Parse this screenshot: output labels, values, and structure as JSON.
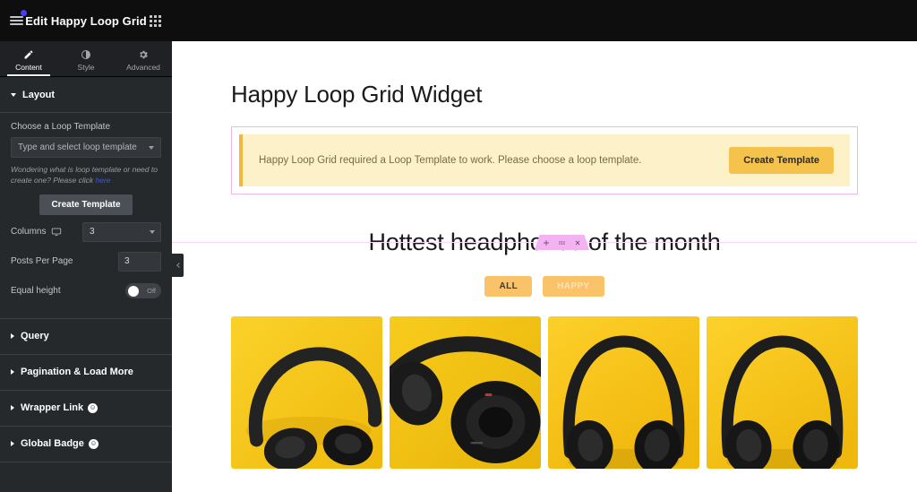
{
  "panel": {
    "header": {
      "menu_icon": "hamburger-menu-icon",
      "title": "Edit Happy Loop Grid",
      "apps_icon": "apps-grid-icon",
      "notification_dot": true
    },
    "tabs": [
      {
        "label": "Content",
        "icon": "pencil-icon",
        "active": true
      },
      {
        "label": "Style",
        "icon": "contrast-half-circle-icon",
        "active": false
      },
      {
        "label": "Advanced",
        "icon": "gear-icon",
        "active": false
      }
    ],
    "layout_section": {
      "title": "Layout",
      "expanded": true,
      "loop_template_label": "Choose a Loop Template",
      "loop_template_value": "Type and select loop template",
      "help_text_before": "Wondering what is loop template or need to create one? Please click ",
      "help_link": "here",
      "create_template_label": "Create Template",
      "columns_label": "Columns",
      "columns_device_icon": "desktop-monitor-icon",
      "columns_value": "3",
      "posts_per_page_label": "Posts Per Page",
      "posts_per_page_value": "3",
      "equal_height_label": "Equal height",
      "equal_height_state": "Off"
    },
    "sections": [
      {
        "label": "Query",
        "pro": false
      },
      {
        "label": "Pagination & Load More",
        "pro": false
      },
      {
        "label": "Wrapper Link",
        "pro": true,
        "pro_icon": "happy-addons-pro-badge-icon"
      },
      {
        "label": "Global Badge",
        "pro": true,
        "pro_icon": "happy-addons-pro-badge-icon"
      }
    ],
    "collapse_handle_icon": "chevron-left-icon"
  },
  "canvas": {
    "widget": {
      "title": "Happy Loop Grid Widget",
      "notice_text": "Happy Loop Grid required a Loop Template to work. Please choose a loop template.",
      "notice_button": "Create Template"
    },
    "element_toolbar": {
      "add_icon": "plus-icon",
      "drag_icon": "drag-handle-dots-icon",
      "close_icon": "close-x-icon"
    },
    "content": {
      "title": "Hottest headphones of the month",
      "filters": [
        {
          "label": "ALL",
          "active": true
        },
        {
          "label": "HAPPY",
          "active": false
        }
      ],
      "cards": [
        {
          "name": "headphones-tilted-left",
          "bg": "#f6c51d"
        },
        {
          "name": "headphones-closeup-angled",
          "bg": "#f2c41f"
        },
        {
          "name": "headphones-front-centered",
          "bg": "#f7c31c"
        },
        {
          "name": "headphones-front-centered-2",
          "bg": "#f7c51e"
        }
      ]
    }
  },
  "colors": {
    "panel_bg": "#26292c",
    "panel_header_bg": "#0e0e0e",
    "accent_blue": "#3858e9",
    "notice_bg": "#fdf1ca",
    "notice_border": "#f0b840",
    "amber_button": "#f5c24c",
    "filter_amber": "#fac36a",
    "section_pink": "#f0b7ef",
    "toolbar_pink": "#f3b3f2"
  }
}
